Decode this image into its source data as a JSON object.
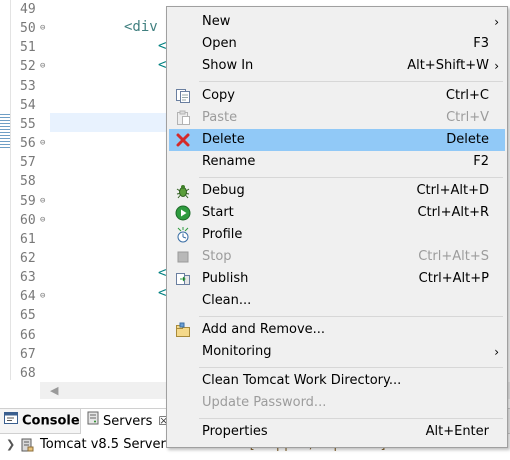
{
  "editor": {
    "line_numbers": [
      "49",
      "50",
      "51",
      "52",
      "53",
      "54",
      "55",
      "56",
      "57",
      "58",
      "59",
      "60",
      "61",
      "62",
      "63",
      "64",
      "65",
      "66",
      "67",
      "68"
    ],
    "fold_markers": {
      "50": "⊖",
      "52": "⊖",
      "56": "⊖",
      "59": "⊖",
      "60": "⊖",
      "64": "⊖"
    },
    "code_div": "<div",
    "bracket": "<"
  },
  "panel": {
    "console_tab": "Console",
    "servers_tab": "Servers",
    "servers_close": "☒",
    "server_name": "Tomcat v8.5 Server at localhost",
    "server_state": "[Stopped, Republish]"
  },
  "menu": {
    "items": [
      {
        "label": "New",
        "shortcut": "",
        "arrow": "›"
      },
      {
        "label": "Open",
        "shortcut": "F3",
        "arrow": ""
      },
      {
        "label": "Show In",
        "shortcut": "Alt+Shift+W",
        "arrow": "›"
      },
      {
        "label": "Copy",
        "shortcut": "Ctrl+C",
        "arrow": ""
      },
      {
        "label": "Paste",
        "shortcut": "Ctrl+V",
        "arrow": ""
      },
      {
        "label": "Delete",
        "shortcut": "Delete",
        "arrow": ""
      },
      {
        "label": "Rename",
        "shortcut": "F2",
        "arrow": ""
      },
      {
        "label": "Debug",
        "shortcut": "Ctrl+Alt+D",
        "arrow": ""
      },
      {
        "label": "Start",
        "shortcut": "Ctrl+Alt+R",
        "arrow": ""
      },
      {
        "label": "Profile",
        "shortcut": "",
        "arrow": ""
      },
      {
        "label": "Stop",
        "shortcut": "Ctrl+Alt+S",
        "arrow": ""
      },
      {
        "label": "Publish",
        "shortcut": "Ctrl+Alt+P",
        "arrow": ""
      },
      {
        "label": "Clean...",
        "shortcut": "",
        "arrow": ""
      },
      {
        "label": "Add and Remove...",
        "shortcut": "",
        "arrow": ""
      },
      {
        "label": "Monitoring",
        "shortcut": "",
        "arrow": "›"
      },
      {
        "label": "Clean Tomcat Work Directory...",
        "shortcut": "",
        "arrow": ""
      },
      {
        "label": "Update Password...",
        "shortcut": "",
        "arrow": ""
      },
      {
        "label": "Properties",
        "shortcut": "Alt+Enter",
        "arrow": ""
      }
    ],
    "highlight_color": "#91c9f7",
    "disabled_color": "#9c9c9c"
  }
}
